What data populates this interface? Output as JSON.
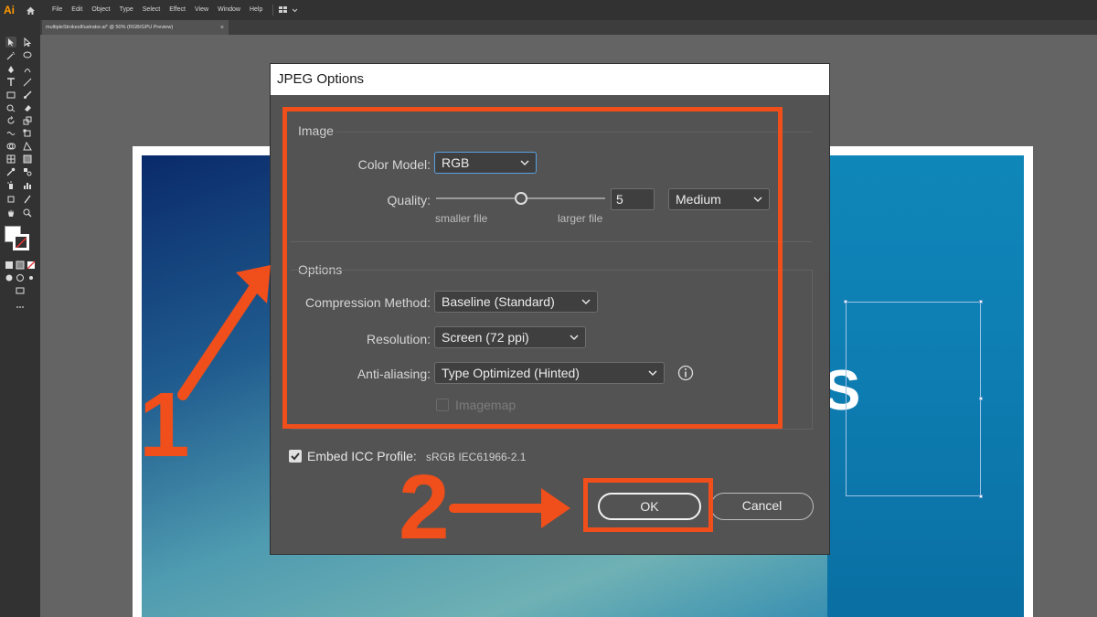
{
  "app": {
    "logo_text": "Ai",
    "menus": [
      "File",
      "Edit",
      "Object",
      "Type",
      "Select",
      "Effect",
      "View",
      "Window",
      "Help"
    ],
    "doc_tab": "multipleStrokesIllustrator.ai* @ 50% (RGB/GPU Preview)",
    "doc_tab_close": "×"
  },
  "dialog": {
    "title": "JPEG Options",
    "image_section": "Image",
    "color_model_label": "Color Model:",
    "color_model_value": "RGB",
    "quality_label": "Quality:",
    "quality_value": "5",
    "quality_level": 0.5,
    "quality_preset": "Medium",
    "smaller_file": "smaller file",
    "larger_file": "larger file",
    "options_section": "Options",
    "compression_label": "Compression Method:",
    "compression_value": "Baseline (Standard)",
    "resolution_label": "Resolution:",
    "resolution_value": "Screen (72 ppi)",
    "antialiasing_label": "Anti-aliasing:",
    "antialiasing_value": "Type Optimized (Hinted)",
    "imagemap_label": "Imagemap",
    "imagemap_checked": false,
    "imagemap_enabled": false,
    "embed_icc_label": "Embed ICC Profile:",
    "embed_icc_checked": true,
    "icc_profile": "sRGB IEC61966-2.1",
    "ok_label": "OK",
    "cancel_label": "Cancel"
  },
  "annotations": {
    "step1": "1",
    "step2": "2",
    "color": "#f04e1a"
  },
  "icons": [
    "home-icon",
    "workspace-grid-icon",
    "chevron-down-icon",
    "info-icon",
    "checkmark-icon"
  ]
}
